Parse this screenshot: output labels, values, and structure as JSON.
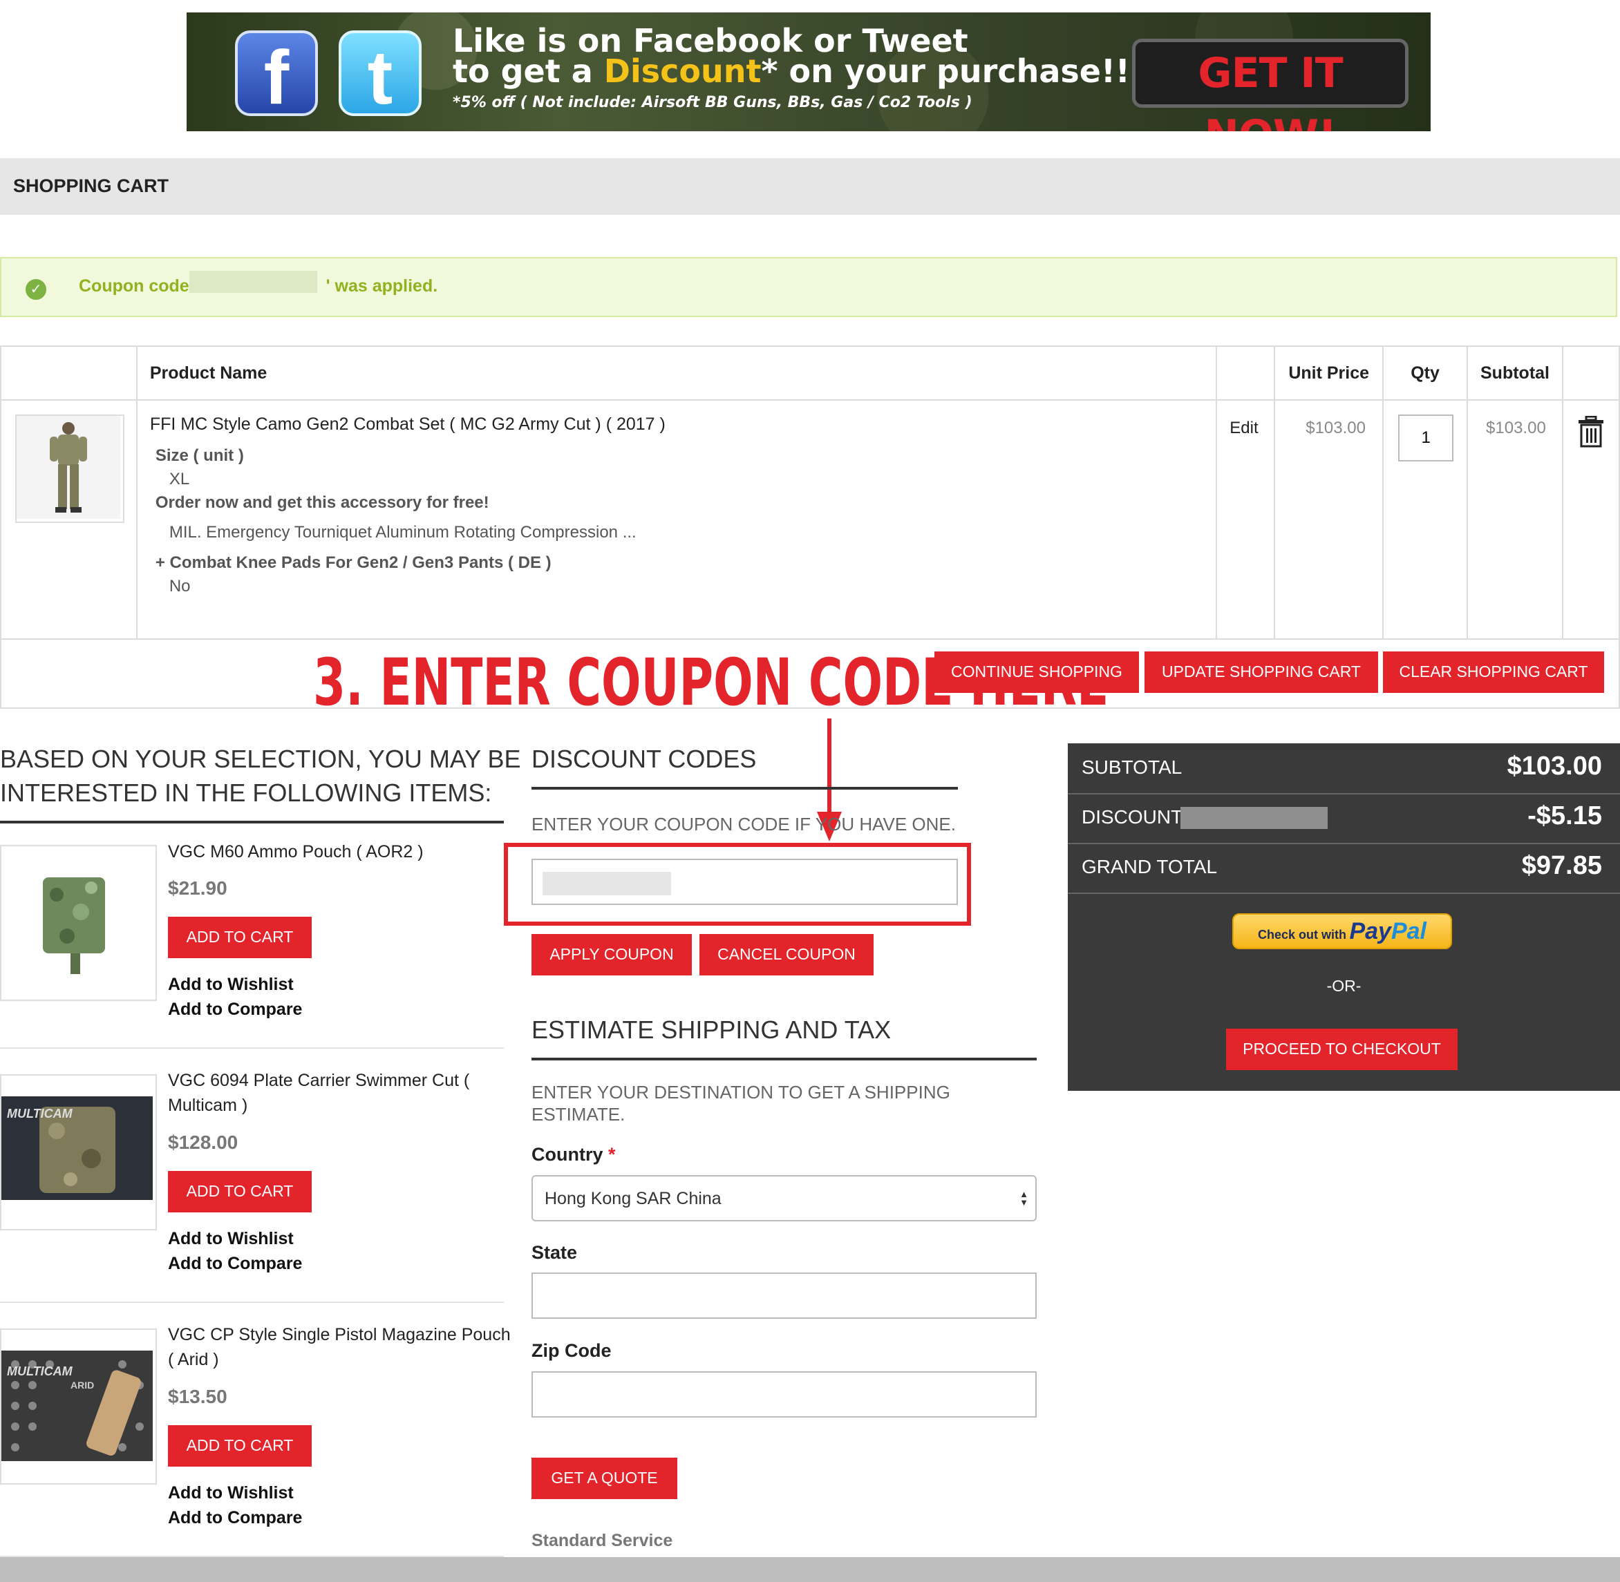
{
  "banner": {
    "line1": "Like is on Facebook or Tweet",
    "line2_pre": "to get a ",
    "line2_highlight": "Discount",
    "line2_post": "* on your purchase!!",
    "line3": "*5% off ( Not include: Airsoft BB Guns, BBs, Gas / Co2 Tools )",
    "cta": "GET IT NOW!",
    "facebook_glyph": "f",
    "twitter_glyph": "t"
  },
  "page": {
    "title": "SHOPPING CART"
  },
  "message": {
    "prefix": "Coupon code '",
    "suffix": "' was applied."
  },
  "cart": {
    "headers": {
      "product_name": "Product Name",
      "unit_price": "Unit Price",
      "qty": "Qty",
      "subtotal": "Subtotal"
    },
    "item": {
      "name": "FFI MC Style Camo Gen2 Combat Set ( MC G2 Army Cut ) ( 2017 )",
      "option1_label": "Size ( unit )",
      "option1_value": "XL",
      "option2_label": "Order now and get this accessory for free!",
      "option2_value": "MIL. Emergency Tourniquet Aluminum Rotating Compression ...",
      "option3_label": "+ Combat Knee Pads For Gen2 / Gen3 Pants ( DE )",
      "option3_value": "No",
      "edit_label": "Edit",
      "unit_price": "$103.00",
      "qty": "1",
      "subtotal": "$103.00"
    },
    "buttons": {
      "continue": "CONTINUE SHOPPING",
      "update": "UPDATE SHOPPING CART",
      "clear": "CLEAR SHOPPING CART"
    }
  },
  "annotation": {
    "text": "3. ENTER COUPON CODE HERE"
  },
  "crosssell": {
    "heading_line1": "BASED ON YOUR SELECTION, YOU MAY BE",
    "heading_line2": "INTERESTED IN THE FOLLOWING ITEMS:",
    "add_to_cart": "ADD TO CART",
    "add_to_wishlist": "Add to Wishlist",
    "add_to_compare": "Add to Compare",
    "items": [
      {
        "title_line1": "VGC M60 Ammo Pouch ( AOR2 )",
        "title_line2": "",
        "price": "$21.90"
      },
      {
        "title_line1": "VGC 6094 Plate Carrier Swimmer Cut (",
        "title_line2": "Multicam )",
        "price": "$128.00"
      },
      {
        "title_line1": "VGC CP Style Single Pistol Magazine Pouch",
        "title_line2": "( Arid )",
        "price": "$13.50"
      }
    ],
    "thumb_labels": {
      "multicam": "MULTICAM",
      "arid": "ARID"
    }
  },
  "discount": {
    "heading": "DISCOUNT CODES",
    "prompt": "ENTER YOUR COUPON CODE IF YOU HAVE ONE.",
    "apply": "APPLY COUPON",
    "cancel": "CANCEL COUPON"
  },
  "shipping": {
    "heading": "ESTIMATE SHIPPING AND TAX",
    "prompt_line1": "ENTER YOUR DESTINATION TO GET A SHIPPING",
    "prompt_line2": "ESTIMATE.",
    "country_label": "Country",
    "required_mark": "*",
    "country_value": "Hong Kong SAR China",
    "state_label": "State",
    "zip_label": "Zip Code",
    "quote": "GET A QUOTE",
    "standard_service": "Standard Service"
  },
  "totals": {
    "subtotal_label": "SUBTOTAL",
    "subtotal_value": "$103.00",
    "discount_label": "DISCOUNT",
    "discount_value": "-$5.15",
    "grand_label": "GRAND TOTAL",
    "grand_value": "$97.85",
    "paypal_prefix": "Check out with",
    "paypal_pay": "Pay",
    "paypal_pal": "Pal",
    "or": "-OR-",
    "checkout": "PROCEED TO CHECKOUT"
  },
  "colors": {
    "accent_red": "#e3242b",
    "success_green": "#8fb21e",
    "totals_bg": "#3a3a3a"
  }
}
